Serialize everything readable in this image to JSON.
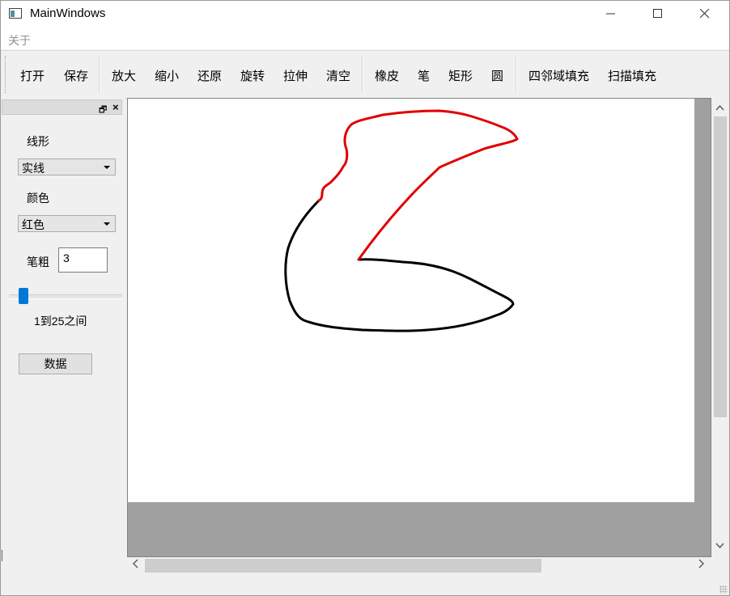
{
  "window": {
    "title": "MainWindows"
  },
  "menubar": {
    "items": [
      "关于"
    ]
  },
  "toolbar": {
    "buttons": [
      "打开",
      "保存",
      "放大",
      "缩小",
      "还原",
      "旋转",
      "拉伸",
      "清空",
      "橡皮",
      "笔",
      "矩形",
      "圆",
      "四邻域填充",
      "扫描填充"
    ]
  },
  "dock": {
    "line_style_label": "线形",
    "line_style_value": "实线",
    "color_label": "颜色",
    "color_value": "红色",
    "pen_width_label": "笔粗",
    "pen_width_value": "3",
    "slider_value": 3,
    "slider_range": [
      1,
      25
    ],
    "range_text": "1到25之间",
    "data_button": "数据"
  },
  "colors": {
    "stroke_red": "#e00000",
    "stroke_black": "#000000",
    "accent": "#0078d7"
  }
}
